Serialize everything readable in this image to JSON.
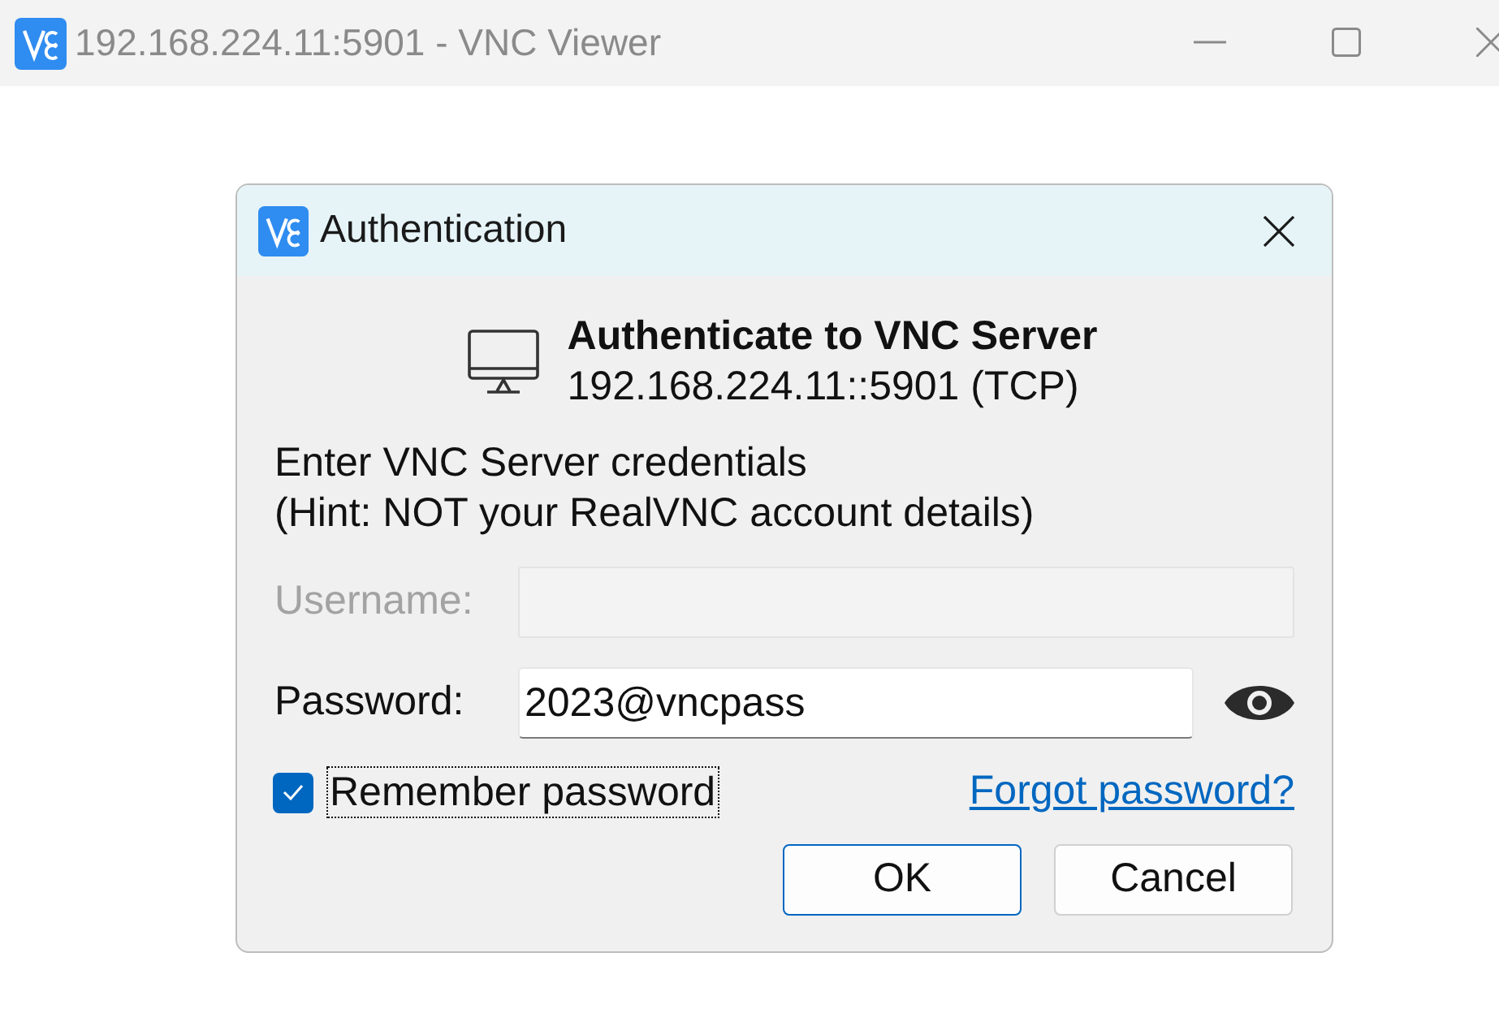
{
  "window": {
    "title": "192.168.224.11:5901 - VNC Viewer"
  },
  "dialog": {
    "title": "Authentication",
    "heading": "Authenticate to VNC Server",
    "server": "192.168.224.11::5901 (TCP)",
    "instructions": [
      "Enter VNC Server credentials",
      "(Hint: NOT your RealVNC account details)"
    ],
    "fields": [
      {
        "label": "Username:",
        "disabled": true,
        "reveal_toggle": false
      },
      {
        "label": "Password:",
        "value": "2023@vncpass",
        "disabled": false,
        "reveal_toggle": true
      }
    ],
    "remember": {
      "label": "Remember password",
      "checked": true,
      "focused": true
    },
    "forgot_link": "Forgot password?",
    "buttons": [
      {
        "label": "OK",
        "default": true
      },
      {
        "label": "Cancel",
        "default": false
      }
    ]
  }
}
